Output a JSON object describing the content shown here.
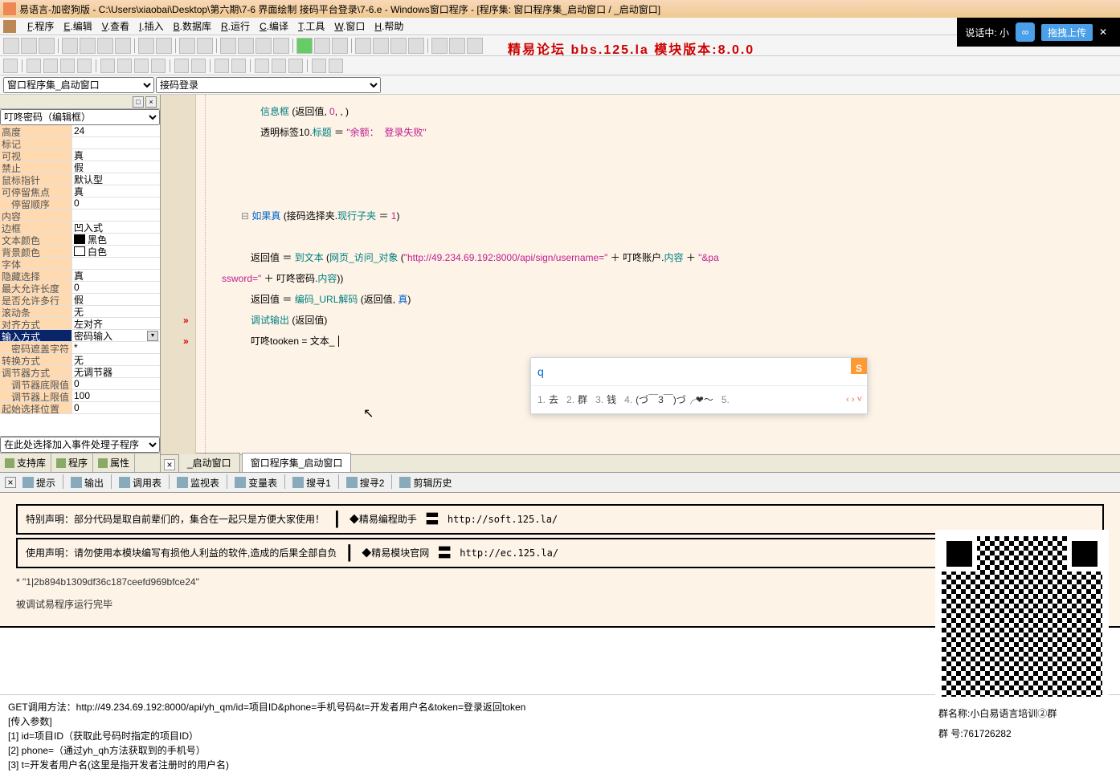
{
  "title": "易语言-加密狗版 - C:\\Users\\xiaobai\\Desktop\\第六期\\7-6 界面绘制 接码平台登录\\7-6.e - Windows窗口程序 - [程序集: 窗口程序集_启动窗口 / _启动窗口]",
  "overlay": {
    "talking": "说话中: 小",
    "upload": "拖拽上传"
  },
  "menu": [
    "F.程序",
    "E.编辑",
    "V.查看",
    "I.插入",
    "B.数据库",
    "R.运行",
    "C.编译",
    "T.工具",
    "W.窗口",
    "H.帮助"
  ],
  "banner": "精易论坛 bbs.125.la 模块版本:8.0.0",
  "selector1": "窗口程序集_启动窗口",
  "selector2": "接码登录",
  "propHeader": "叮咚密码（编辑框）",
  "props": [
    {
      "k": "高度",
      "v": "24"
    },
    {
      "k": "标记",
      "v": ""
    },
    {
      "k": "可视",
      "v": "真"
    },
    {
      "k": "禁止",
      "v": "假"
    },
    {
      "k": "鼠标指针",
      "v": "默认型"
    },
    {
      "k": "可停留焦点",
      "v": "真"
    },
    {
      "k": "停留顺序",
      "v": "0",
      "ind": true
    },
    {
      "k": "内容",
      "v": ""
    },
    {
      "k": "边框",
      "v": "凹入式"
    },
    {
      "k": "文本颜色",
      "v": "黑色",
      "sw": "#000000"
    },
    {
      "k": "背景颜色",
      "v": "白色",
      "sw": "#ffffff"
    },
    {
      "k": "字体",
      "v": ""
    },
    {
      "k": "隐藏选择",
      "v": "真"
    },
    {
      "k": "最大允许长度",
      "v": "0"
    },
    {
      "k": "是否允许多行",
      "v": "假"
    },
    {
      "k": "滚动条",
      "v": "无"
    },
    {
      "k": "对齐方式",
      "v": "左对齐"
    },
    {
      "k": "输入方式",
      "v": "密码输入",
      "hl": true,
      "dd": true
    },
    {
      "k": "密码遮盖字符",
      "v": "*",
      "ind": true
    },
    {
      "k": "转换方式",
      "v": "无"
    },
    {
      "k": "调节器方式",
      "v": "无调节器"
    },
    {
      "k": "调节器底限值",
      "v": "0",
      "ind": true
    },
    {
      "k": "调节器上限值",
      "v": "100",
      "ind": true
    },
    {
      "k": "起始选择位置",
      "v": "0"
    }
  ],
  "lpFooterSel": "在此处选择加入事件处理子程序",
  "lpTabs": [
    "支持库",
    "程序",
    "属性"
  ],
  "code": {
    "l1a": "信息框 ",
    "l1b": "(",
    "l1c": "返回值",
    "l1d": ", ",
    "l1e": "0",
    "l1f": ", , )",
    "l2a": "透明标签10",
    "l2b": ".",
    "l2c": "标题",
    "l2d": " ＝ ",
    "l2e": "\"余额：  登录失败\"",
    "l3a": "如果真 ",
    "l3b": "(",
    "l3c": "接码选择夹",
    "l3d": ".",
    "l3e": "现行子夹",
    "l3f": " ＝ ",
    "l3g": "1",
    "l3h": ")",
    "l4a": "返回值",
    "l4b": " ＝ ",
    "l4c": "到文本 ",
    "l4d": "(",
    "l4e": "网页_访问_对象 ",
    "l4f": "(",
    "l4g": "\"http://49.234.69.192:8000/api/sign/username=\"",
    "l4h": " ＋ ",
    "l4i": "叮咚账户",
    "l4j": ".",
    "l4k": "内容",
    "l4l": " ＋ ",
    "l4m": "\"&pa",
    "l4n": "ssword=\"",
    "l4o": " ＋ ",
    "l4p": "叮咚密码",
    "l4q": ".",
    "l4r": "内容",
    "l4s": "))",
    "l5a": "返回值",
    "l5b": " ＝ ",
    "l5c": "编码_URL解码 ",
    "l5d": "(",
    "l5e": "返回值",
    "l5f": ", ",
    "l5g": "真",
    "l5h": ")",
    "l6a": "调试输出 ",
    "l6b": "(",
    "l6c": "返回值",
    "l6d": ")",
    "l7a": "叮咚tooken",
    "l7b": " = ",
    "l7c": "文本_"
  },
  "ime": {
    "input": "q",
    "cands": [
      {
        "n": "1.",
        "c": "去"
      },
      {
        "n": "2.",
        "c": "群"
      },
      {
        "n": "3.",
        "c": "钱"
      },
      {
        "n": "4.",
        "c": "(づ￣3￣)づ╭❤～"
      },
      {
        "n": "5.",
        "c": ""
      }
    ]
  },
  "codeTabs": [
    "_启动窗口",
    "窗口程序集_启动窗口"
  ],
  "bottomTabs": [
    "提示",
    "输出",
    "调用表",
    "监视表",
    "变量表",
    "搜寻1",
    "搜寻2",
    "剪辑历史"
  ],
  "out": {
    "decl1a": "特别声明：",
    "decl1b": "部分代码是取自前辈们的，集合在一起只是方便大家使用！",
    "h1": "◆精易编程助手",
    "u1": "http://soft.125.la/",
    "decl2a": "使用声明：",
    "decl2b": "请勿使用本模块编写有损他人利益的软件,造成的后果全部自负",
    "h2": "◆精易模块官网",
    "u2": "http://ec.125.la/",
    "o1": "* \"1|2b894b1309df36c187ceefd969bfce24\"",
    "o2": "被调试易程序运行完毕"
  },
  "qr": {
    "name": "群名称:小白易语言培训②群",
    "num": "群    号:761726282"
  },
  "footer": {
    "l1": "GET调用方法：http://49.234.69.192:8000/api/yh_qm/id=项目ID&phone=手机号码&t=开发者用户名&token=登录返回token",
    "l2": "[传入参数]",
    "l3": "[1] id=项目ID（获取此号码时指定的项目ID）",
    "l4": "[2] phone=（通过yh_qh方法获取到的手机号）",
    "l5": "[3] t=开发者用户名(这里是指开发者注册时的用户名)"
  }
}
